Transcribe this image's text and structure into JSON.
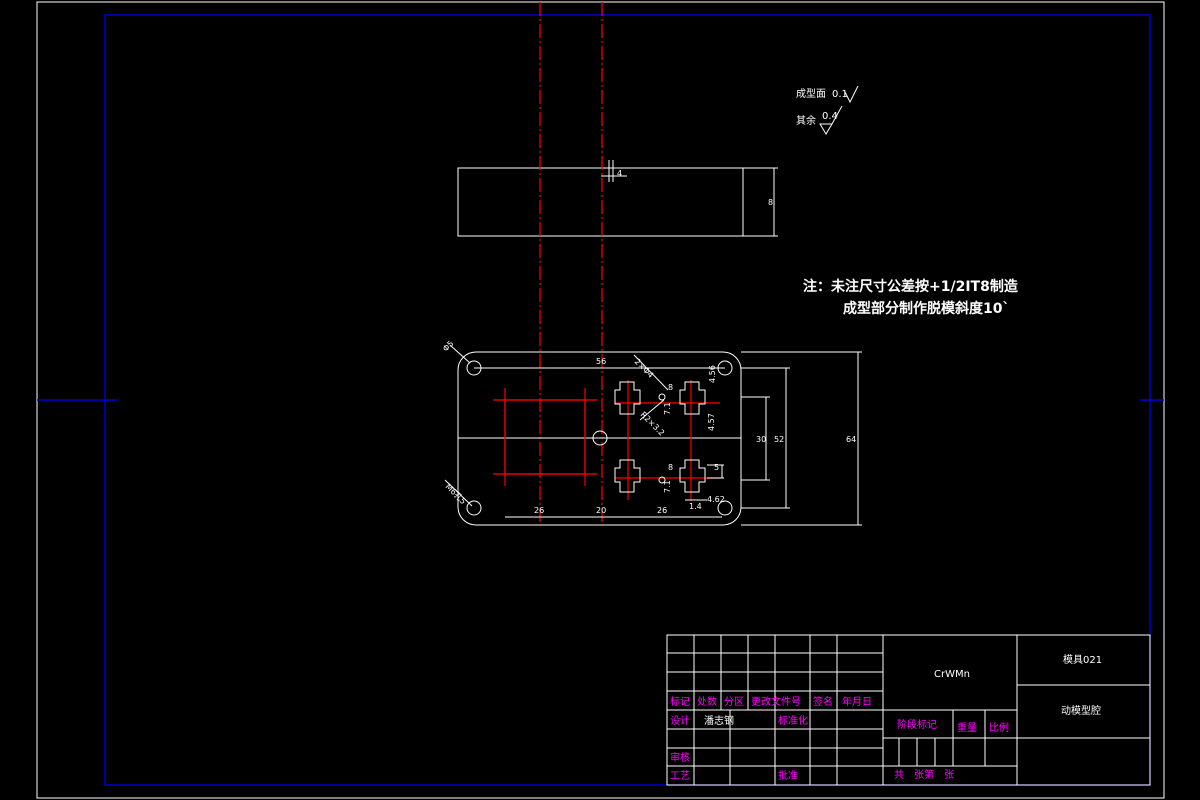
{
  "notes": {
    "line1": "注：未注尺寸公差按+1/2IT8制造",
    "line2": "成型部分制作脱模斜度10`"
  },
  "roughness": {
    "label1": "成型面",
    "value1": "0.1",
    "label2": "其余",
    "value2": "0.4"
  },
  "dimensions": {
    "d_top_width": "56",
    "d_bottom_26a": "26",
    "d_bottom_20": "20",
    "d_bottom_26b": "26",
    "d_52": "52",
    "d_64": "64",
    "d_30": "30",
    "d_hole_label": "Φ5",
    "d_screw_label": "M6孔5",
    "d_2x": "2×Φ4",
    "d_r2": "R2×3.2",
    "d_8a": "8",
    "d_8b": "8",
    "d_71a": "7.1",
    "d_71b": "7.1",
    "d_457": "4.57",
    "d_456": "4.56",
    "d_5": "5",
    "d_462": "4.62",
    "d_14": "1.4",
    "d_side_8": "8",
    "d_front": "4"
  },
  "title_block": {
    "material": "CrWMn",
    "drawing_no": "模具021",
    "part_name": "动模型腔",
    "row_labels": {
      "mark": "标记",
      "count": "处数",
      "zone": "分区",
      "change_doc": "更改文件号",
      "sign": "签名",
      "date": "年月日",
      "design": "设计",
      "design_name": "潘志钢",
      "standardize": "标准化",
      "review": "审核",
      "process": "工艺",
      "approve": "批准"
    },
    "stage_mark": "阶段标记",
    "weight": "重量",
    "scale": "比例",
    "sheets": "共　张第　张"
  }
}
